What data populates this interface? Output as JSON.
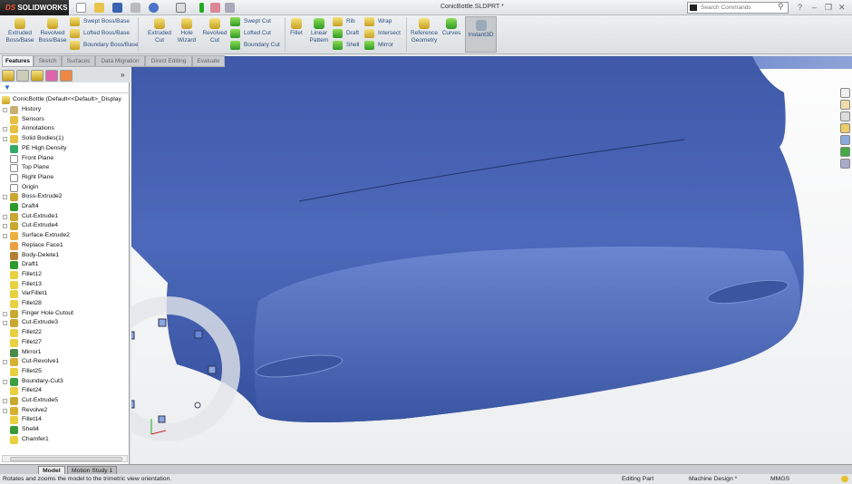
{
  "app": {
    "brand": "SOLIDWORKS",
    "brand_prefix": "DS",
    "document_title": "ConicBottle.SLDPRT *"
  },
  "search": {
    "placeholder": "Search Commands"
  },
  "ribbon": {
    "large": [
      {
        "label1": "Extruded",
        "label2": "Boss/Base"
      },
      {
        "label1": "Revolved",
        "label2": "Boss/Base"
      },
      {
        "label1": "Extruded",
        "label2": "Cut"
      },
      {
        "label1": "Hole",
        "label2": "Wizard"
      },
      {
        "label1": "Revolved",
        "label2": "Cut"
      },
      {
        "label1": "Fillet",
        "label2": ""
      },
      {
        "label1": "Linear",
        "label2": "Pattern"
      },
      {
        "label1": "Reference",
        "label2": "Geometry"
      },
      {
        "label1": "Curves",
        "label2": ""
      },
      {
        "label1": "Instant3D",
        "label2": ""
      }
    ],
    "small_boss": [
      "Swept Boss/Base",
      "Lofted Boss/Base",
      "Boundary Boss/Base"
    ],
    "small_cut": [
      "Swept Cut",
      "Lofted Cut",
      "Boundary Cut"
    ],
    "small_features1": [
      "Rib",
      "Draft",
      "Shell"
    ],
    "small_features2": [
      "Wrap",
      "Intersect",
      "Mirror"
    ]
  },
  "tabs": [
    {
      "label": "Features",
      "active": true
    },
    {
      "label": "Sketch"
    },
    {
      "label": "Surfaces"
    },
    {
      "label": "Data Migration"
    },
    {
      "label": "Direct Editing"
    },
    {
      "label": "Evaluate"
    }
  ],
  "tree": {
    "root": "ConicBottle  (Default<<Default>_Display",
    "items": [
      {
        "label": "History",
        "exp": true,
        "icon": "history"
      },
      {
        "label": "Sensors",
        "icon": "sensor"
      },
      {
        "label": "Annotations",
        "exp": true,
        "icon": "annotation"
      },
      {
        "label": "Solid Bodies(1)",
        "exp": true,
        "icon": "folder"
      },
      {
        "label": "PE High Density",
        "icon": "material"
      },
      {
        "label": "Front Plane",
        "icon": "plane"
      },
      {
        "label": "Top Plane",
        "icon": "plane"
      },
      {
        "label": "Right Plane",
        "icon": "plane"
      },
      {
        "label": "Origin",
        "icon": "origin"
      },
      {
        "label": "Boss-Extrude2",
        "exp": true,
        "icon": "extrude"
      },
      {
        "label": "Draft4",
        "icon": "draft"
      },
      {
        "label": "Cut-Extrude1",
        "exp": true,
        "icon": "extrude"
      },
      {
        "label": "Cut-Extrude4",
        "exp": true,
        "icon": "extrude"
      },
      {
        "label": "Surface-Extrude2",
        "exp": true,
        "icon": "surface"
      },
      {
        "label": "Replace Face1",
        "icon": "replace"
      },
      {
        "label": "Body-Delete1",
        "icon": "delete"
      },
      {
        "label": "Draft1",
        "icon": "draft"
      },
      {
        "label": "Fillet12",
        "icon": "fillet"
      },
      {
        "label": "Fillet13",
        "icon": "fillet"
      },
      {
        "label": "VarFillet1",
        "icon": "fillet"
      },
      {
        "label": "Fillet28",
        "icon": "fillet"
      },
      {
        "label": "Finger Hole Cutout",
        "exp": true,
        "icon": "extrude"
      },
      {
        "label": "Cut-Extrude3",
        "exp": true,
        "icon": "extrude"
      },
      {
        "label": "Fillet22",
        "icon": "fillet"
      },
      {
        "label": "Fillet27",
        "icon": "fillet"
      },
      {
        "label": "Mirror1",
        "icon": "mirror"
      },
      {
        "label": "Cut-Revolve1",
        "exp": true,
        "icon": "revolve"
      },
      {
        "label": "Fillet25",
        "icon": "fillet"
      },
      {
        "label": "Boundary-Cut3",
        "exp": true,
        "icon": "boundary"
      },
      {
        "label": "Fillet24",
        "icon": "fillet"
      },
      {
        "label": "Cut-Extrude5",
        "exp": true,
        "icon": "extrude"
      },
      {
        "label": "Revolve2",
        "exp": true,
        "icon": "revolve"
      },
      {
        "label": "Fillet14",
        "icon": "fillet"
      },
      {
        "label": "Shell4",
        "icon": "shell"
      },
      {
        "label": "Chamfer1",
        "icon": "fillet"
      }
    ]
  },
  "bottom_tabs": [
    {
      "label": "Model",
      "active": true
    },
    {
      "label": "Motion Study 1"
    }
  ],
  "status": {
    "message": "Rotates and zooms the model to the trimetric view orientation.",
    "mode": "Editing Part",
    "config": "Machine Design *",
    "units": "MMGS"
  },
  "colors": {
    "model": "#4a66b8",
    "accent": "#2a4e80"
  }
}
